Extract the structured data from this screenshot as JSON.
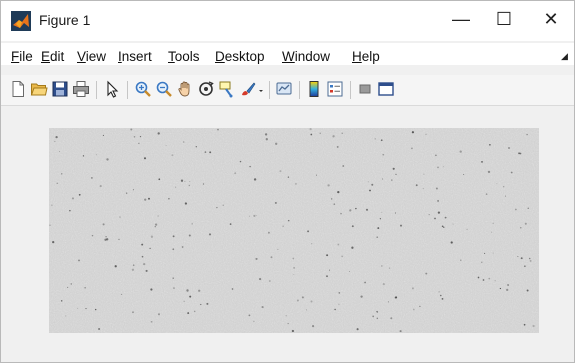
{
  "window": {
    "title": "Figure 1",
    "min_glyph": "—",
    "max_glyph": "☐",
    "close_glyph": "✕"
  },
  "menu": {
    "items": [
      {
        "key": "F",
        "rest": "ile"
      },
      {
        "key": "E",
        "rest": "dit"
      },
      {
        "key": "V",
        "rest": "iew"
      },
      {
        "key": "I",
        "rest": "nsert"
      },
      {
        "key": "T",
        "rest": "ools"
      },
      {
        "key": "D",
        "rest": "esktop"
      },
      {
        "key": "W",
        "rest": "indow"
      },
      {
        "key": "H",
        "rest": "elp"
      }
    ],
    "overflow_glyph": "◢"
  },
  "toolbar": {
    "icons": [
      "new-figure-icon",
      "open-file-icon",
      "save-icon",
      "print-icon",
      "edit-plot-icon",
      "zoom-in-icon",
      "zoom-out-icon",
      "pan-icon",
      "rotate-3d-icon",
      "data-cursor-icon",
      "brush-icon",
      "link-plot-icon",
      "colorbar-icon",
      "legend-icon",
      "hide-plot-tools-icon",
      "show-plot-tools-icon"
    ]
  },
  "colors": {
    "image_base": "#cfcfcf",
    "background": "#f0f0f0",
    "matlab_orange": "#e8741b"
  }
}
